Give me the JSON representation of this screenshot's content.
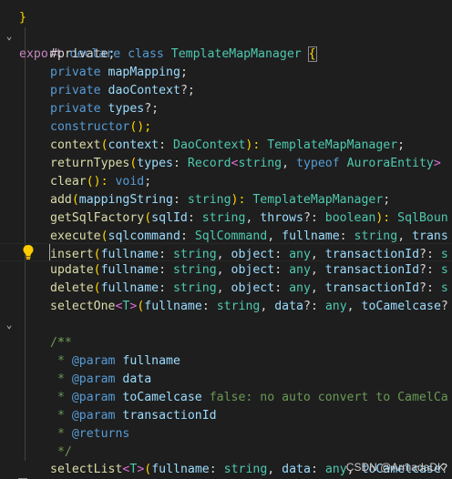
{
  "code": {
    "l0": "}",
    "l1": {
      "export": "export",
      "declare": "declare",
      "class": "class",
      "name": "TemplateMapManager",
      "open": "{"
    },
    "l2": "#private;",
    "l3": {
      "kw": "private",
      "name": "mapMapping",
      "end": ";"
    },
    "l4": {
      "kw": "private",
      "name": "daoContext",
      "end": "?;"
    },
    "l5": {
      "kw": "private",
      "name": "types",
      "end": "?;"
    },
    "l6": {
      "kw": "constructor",
      "end": "();"
    },
    "l7": {
      "fn": "context",
      "p1": "(",
      "param": "context",
      "sep": ": ",
      "type": "DaoContext",
      "p2": "): ",
      "ret": "TemplateMapManager",
      "end": ";"
    },
    "l8": {
      "fn": "returnTypes",
      "p1": "(",
      "param": "types",
      "sep": ": ",
      "type": "Record",
      "lt": "<",
      "t1": "string",
      "comma": ", ",
      "typeof": "typeof",
      "t2": " AuroraEntity",
      "gt": ">"
    },
    "l9": {
      "fn": "clear",
      "p": "(): ",
      "ret": "void",
      "end": ";"
    },
    "l10": {
      "fn": "add",
      "p1": "(",
      "param": "mappingString",
      "sep": ": ",
      "type": "string",
      "p2": "): ",
      "ret": "TemplateMapManager",
      "end": ";"
    },
    "l11": {
      "fn": "getSqlFactory",
      "p1": "(",
      "param": "sqlId",
      "sep": ": ",
      "type": "string",
      "comma": ", ",
      "param2": "throws",
      "sep2": "?: ",
      "type2": "boolean",
      "p2": "): ",
      "ret": "SqlBoun"
    },
    "l12": {
      "fn": "execute",
      "p1": "(",
      "param": "sqlcommand",
      "sep": ": ",
      "type": "SqlCommand",
      "comma": ", ",
      "param2": "fullname",
      "sep2": ": ",
      "type2": "string",
      "comma2": ", ",
      "param3": "trans"
    },
    "l13": {
      "fn": "insert",
      "p1": "(",
      "param": "fullname",
      "sep": ": ",
      "type": "string",
      "comma": ", ",
      "param2": "object",
      "sep2": ": ",
      "type2": "any",
      "comma2": ", ",
      "param3": "transactionId",
      "sep3": "?: ",
      "tail": "s"
    },
    "l14": {
      "fn": "update",
      "p1": "(",
      "param": "fullname",
      "sep": ": ",
      "type": "string",
      "comma": ", ",
      "param2": "object",
      "sep2": ": ",
      "type2": "any",
      "comma2": ", ",
      "param3": "transactionId",
      "sep3": "?: ",
      "tail": "s"
    },
    "l15": {
      "fn": "delete",
      "p1": "(",
      "param": "fullname",
      "sep": ": ",
      "type": "string",
      "comma": ", ",
      "param2": "object",
      "sep2": ": ",
      "type2": "any",
      "comma2": ", ",
      "param3": "transactionId",
      "sep3": "?: ",
      "tail": "s"
    },
    "l16": {
      "fn": "selectOne",
      "lt": "<",
      "T": "T",
      "gt": ">",
      "p1": "(",
      "param": "fullname",
      "sep": ": ",
      "type": "string",
      "comma": ", ",
      "param2": "data",
      "sep2": "?: ",
      "type2": "any",
      "comma2": ", ",
      "param3": "toCamelcase",
      "tail": "?"
    },
    "l17": "/**",
    "l18": " *",
    "l19": {
      "star": " * ",
      "tag": "@param",
      "name": " fullname"
    },
    "l20": {
      "star": " * ",
      "tag": "@param",
      "name": " data"
    },
    "l21": {
      "star": " * ",
      "tag": "@param",
      "name": " toCamelcase",
      "desc": " false: no auto convert to CamelCa"
    },
    "l22": {
      "star": " * ",
      "tag": "@param",
      "name": " transactionId"
    },
    "l23": {
      "star": " * ",
      "tag": "@returns"
    },
    "l24": " */",
    "l25": {
      "fn": "selectList",
      "lt": "<",
      "T": "T",
      "gt": ">",
      "p1": "(",
      "param": "fullname",
      "sep": ": ",
      "type": "string",
      "comma": ", ",
      "param2": "data",
      "sep2": ": ",
      "type2": "any",
      "comma2": ", ",
      "param3": "toCamelcase",
      "tail": "?"
    },
    "l26": "}"
  },
  "watermark": "CSDN @ArmadaDK",
  "icons": {
    "fold": "chevron-down-icon",
    "lightbulb": "lightbulb-icon"
  },
  "colors": {
    "background": "#1e1e1e",
    "keyword": "#569cd6",
    "type": "#4ec9b0",
    "function": "#dcdcaa",
    "param": "#9cdcfe",
    "comment": "#6a9955",
    "bracket": "#ffd700"
  }
}
